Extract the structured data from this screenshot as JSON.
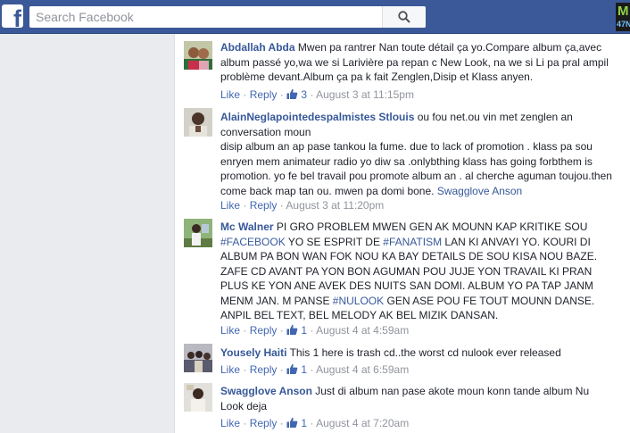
{
  "header": {
    "logo": "f",
    "search_placeholder": "Search Facebook",
    "corner_badge_top": "M",
    "corner_badge_bottom": "47N"
  },
  "colors": {
    "brand": "#3b5998",
    "link": "#365899",
    "meta": "#90949c"
  },
  "actions": {
    "like": "Like",
    "reply": "Reply",
    "dot": "·"
  },
  "comments": [
    {
      "author": "Abdallah Abda",
      "parts": [
        {
          "t": "Mwen pa rantrer Nan toute détail ça yo.Compare album ça,avec album passé yo,wa we si Larivière pa repan c New Look, na we si Li pa pral ampil problème devant.Album ça pa k fait Zenglen,Disip et Klass anyen."
        }
      ],
      "likes": "3",
      "time": "August 3 at 11:15pm"
    },
    {
      "author": "AlainNeglapointedespalmistes Stlouis",
      "parts": [
        {
          "t": "ou fou net.ou vin met zenglen an conversation moun"
        },
        {
          "br": true
        },
        {
          "t": "disip album an ap pase tankou la fume. due to lack of promotion . klass pa sou enryen mem animateur radio yo diw sa .onlybthing klass has going forbthem is promotion. yo fe bel travail pou promote album an . al cherche aguman toujou.then come back map tan ou. mwen pa domi bone. "
        },
        {
          "l": "Swagglove Anson"
        }
      ],
      "likes": "",
      "time": "August 3 at 11:20pm"
    },
    {
      "author": "Mc Walner",
      "parts": [
        {
          "t": "PI GRO PROBLEM MWEN GEN AK MOUNN KAP KRITIKE SOU "
        },
        {
          "l": "#FACEBOOK"
        },
        {
          "t": " YO SE ESPRIT DE "
        },
        {
          "l": "#FANATISM"
        },
        {
          "t": " LAN KI ANVAYI YO. KOURI DI ALBUM PA BON WAN FOK NOU KA BAY DETAILS DE SOU KISA NOU BAZE. ZAFE CD AVANT PA YON BON AGUMAN POU JUJE YON TRAVAIL KI PRAN PLUS KE YON ANE AVEK DES NUITS SAN DOMI. ALBUM YO PA TAP JANM MENM JAN. M PANSE "
        },
        {
          "l": "#NULOOK"
        },
        {
          "t": " GEN ASE POU FE TOUT MOUNN DANSE. ANPIL BEL TEXT, BEL MELODY AK BEL MIZIK DANSAN."
        }
      ],
      "likes": "1",
      "time": "August 4 at 4:59am"
    },
    {
      "author": "Yousely Haiti",
      "parts": [
        {
          "t": "This 1 here is trash cd..the worst cd nulook ever released"
        }
      ],
      "likes": "1",
      "time": "August 4 at 6:59am"
    },
    {
      "author": "Swagglove Anson",
      "parts": [
        {
          "t": "Just di album nan pase akote moun konn tande album Nu Look deja"
        }
      ],
      "likes": "1",
      "time": "August 4 at 7:20am"
    }
  ]
}
